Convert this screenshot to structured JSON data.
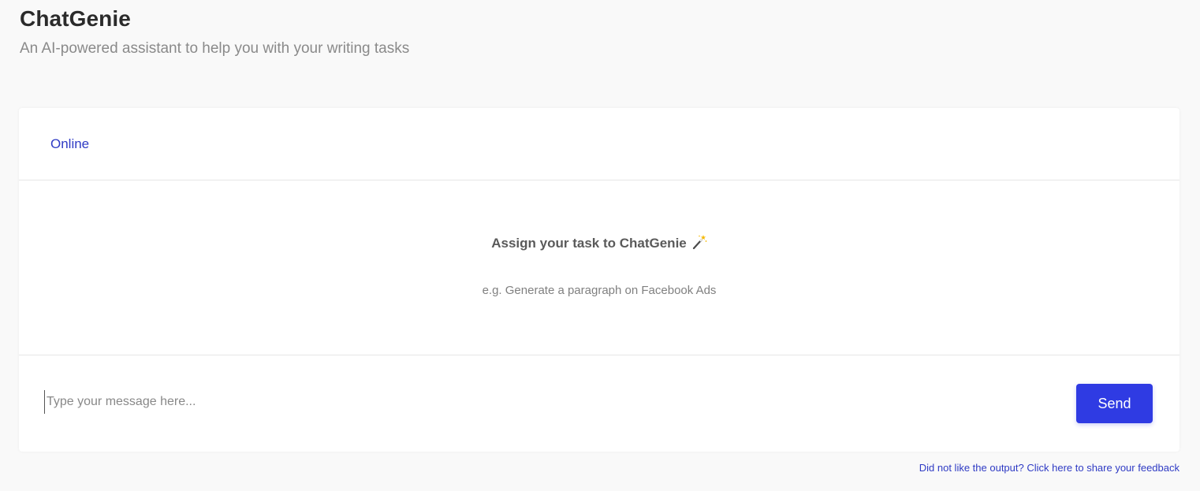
{
  "header": {
    "title": "ChatGenie",
    "subtitle": "An AI-powered assistant to help you with your writing tasks"
  },
  "chat": {
    "status": "Online",
    "empty_state": {
      "title": "Assign your task to ChatGenie",
      "title_icon": "magic-wand-icon",
      "example": "e.g. Generate a paragraph on Facebook Ads"
    },
    "input": {
      "value": "",
      "placeholder": "Type your message here..."
    },
    "send_label": "Send"
  },
  "footer": {
    "feedback_link": "Did not like the output? Click here to share your feedback"
  },
  "colors": {
    "accent": "#2f3be3",
    "link": "#2f3bc4",
    "background": "#f9f9f9",
    "card": "#ffffff"
  }
}
